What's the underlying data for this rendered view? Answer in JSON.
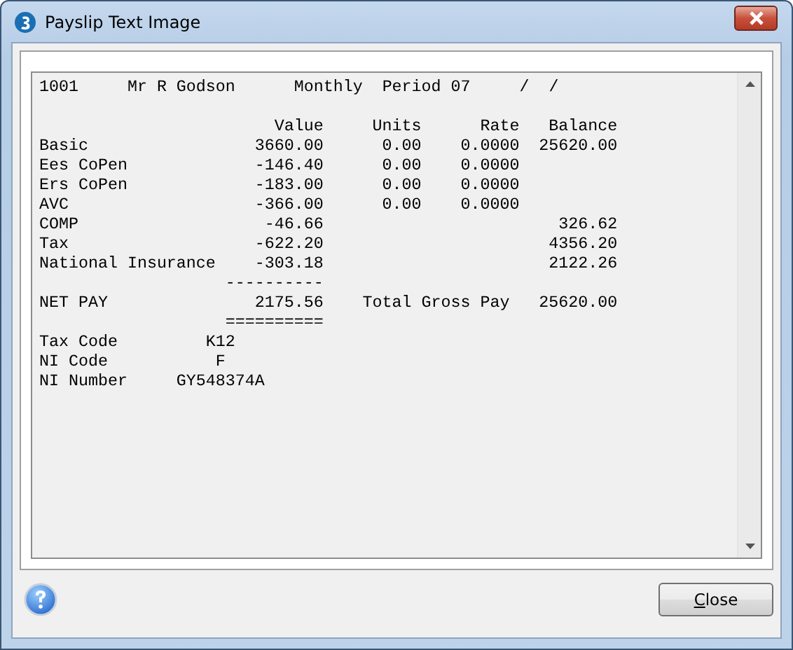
{
  "window": {
    "title": "Payslip Text Image"
  },
  "header": {
    "employee_id": "1001",
    "name": "Mr R Godson",
    "frequency": "Monthly",
    "period": "Period 07",
    "date": "/  /"
  },
  "columns": [
    "Value",
    "Units",
    "Rate",
    "Balance"
  ],
  "rows": [
    {
      "label": "Basic",
      "value": "3660.00",
      "units": "0.00",
      "rate": "0.0000",
      "balance": "25620.00"
    },
    {
      "label": "Ees CoPen",
      "value": "-146.40",
      "units": "0.00",
      "rate": "0.0000"
    },
    {
      "label": "Ers CoPen",
      "value": "-183.00",
      "units": "0.00",
      "rate": "0.0000"
    },
    {
      "label": "AVC",
      "value": "-366.00",
      "units": "0.00",
      "rate": "0.0000"
    },
    {
      "label": "COMP",
      "value": "-46.66",
      "balance": "326.62"
    },
    {
      "label": "Tax",
      "value": "-622.20",
      "balance": "4356.20"
    },
    {
      "label": "National Insurance",
      "value": "-303.18",
      "balance": "2122.26"
    }
  ],
  "rule_above": "----------",
  "net_pay": {
    "label": "NET PAY",
    "value": "2175.56",
    "gross_label": "Total Gross Pay",
    "gross_value": "25620.00"
  },
  "rule_below": "==========",
  "codes": [
    {
      "label": "Tax Code",
      "value": "K12"
    },
    {
      "label": "NI Code",
      "value": "F"
    },
    {
      "label": "NI Number",
      "value": "GY548374A"
    }
  ],
  "buttons": [
    {
      "label_parts": [
        {
          "text": "C",
          "underlined": true
        },
        {
          "text": "lose",
          "underlined": false
        }
      ]
    }
  ]
}
